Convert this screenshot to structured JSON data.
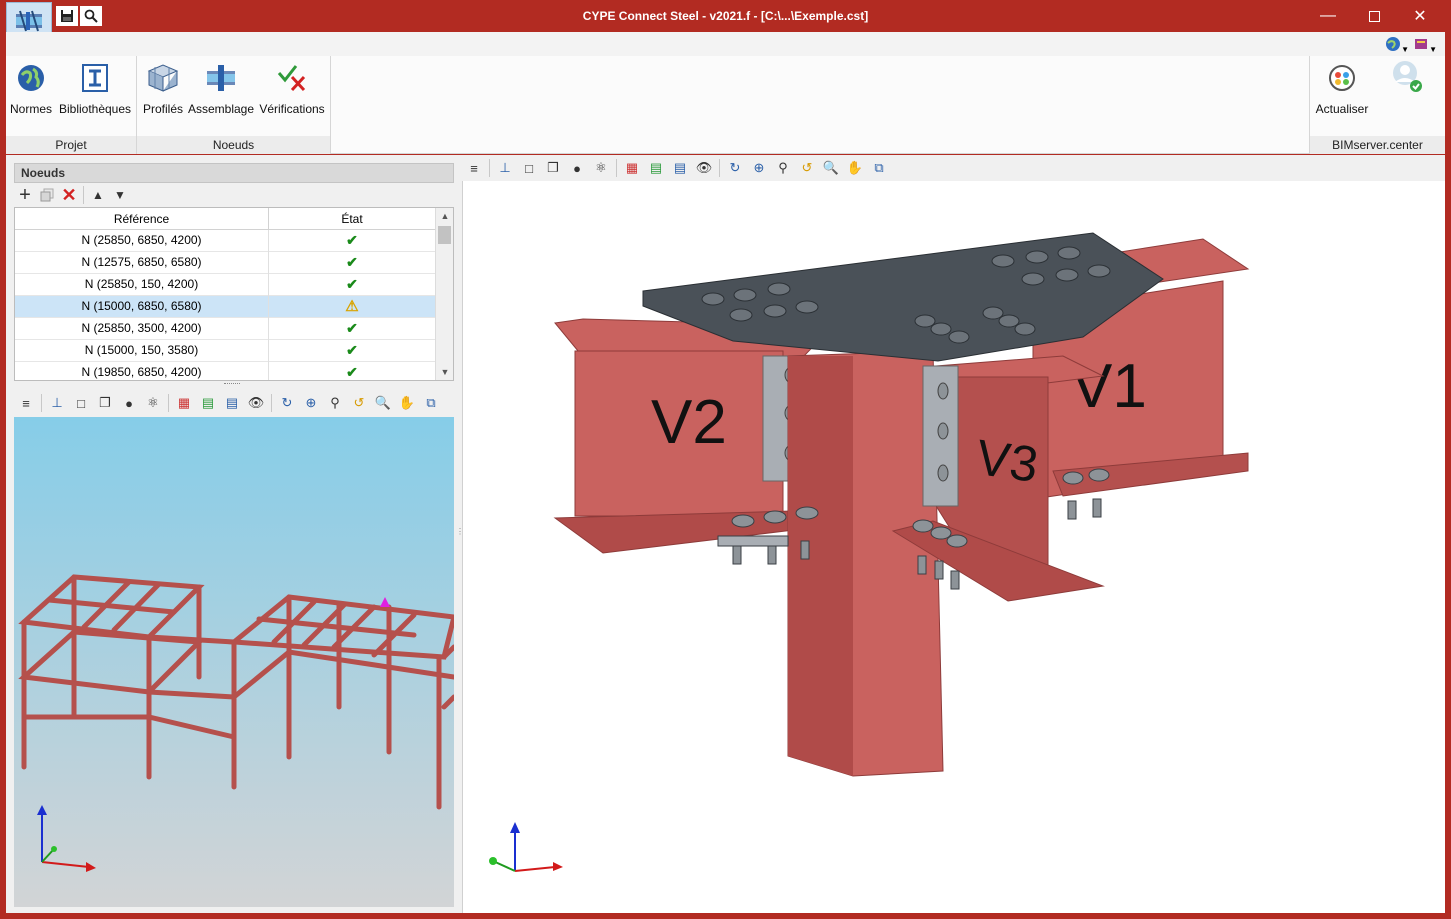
{
  "window": {
    "title": "CYPE Connect Steel - v2021.f - [C:\\...\\Exemple.cst]",
    "accent": "#b22b22"
  },
  "quick_access": [
    {
      "icon": "save-icon"
    },
    {
      "icon": "search-icon"
    }
  ],
  "ribbon": {
    "groups": [
      {
        "label": "Projet",
        "buttons": [
          {
            "label": "Normes",
            "icon": "globe-icon"
          },
          {
            "label": "Bibliothèques",
            "icon": "library-icon"
          }
        ]
      },
      {
        "label": "Noeuds",
        "buttons": [
          {
            "label": "Profilés",
            "icon": "profiles-icon"
          },
          {
            "label": "Assemblage",
            "icon": "assembly-icon"
          },
          {
            "label": "Vérifications",
            "icon": "checks-icon"
          }
        ]
      },
      {
        "label": "BIMserver.center",
        "buttons": [
          {
            "label": "Actualiser",
            "icon": "refresh-icon"
          }
        ]
      }
    ]
  },
  "nodes_panel": {
    "title": "Noeuds",
    "columns": [
      "Référence",
      "État"
    ],
    "rows": [
      {
        "ref": "N (25850, 6850, 4200)",
        "state": "ok"
      },
      {
        "ref": "N (12575, 6850, 6580)",
        "state": "ok"
      },
      {
        "ref": "N (25850, 150, 4200)",
        "state": "ok"
      },
      {
        "ref": "N (15000, 6850, 6580)",
        "state": "warning",
        "selected": true
      },
      {
        "ref": "N (25850, 3500, 4200)",
        "state": "ok"
      },
      {
        "ref": "N (15000, 150, 3580)",
        "state": "ok"
      },
      {
        "ref": "N (19850, 6850, 4200)",
        "state": "ok"
      }
    ],
    "glyphs": {
      "ok": "✔",
      "warning": "⚠"
    }
  },
  "model_labels": {
    "beam_1": "V1",
    "beam_2": "V2",
    "beam_3": "V3"
  },
  "colors": {
    "steel": "#c9625f",
    "steel_dark": "#8e3b3a",
    "plate": "#4a5158",
    "sky_top": "#86cde8",
    "sky_bottom": "#d2d4d6"
  }
}
